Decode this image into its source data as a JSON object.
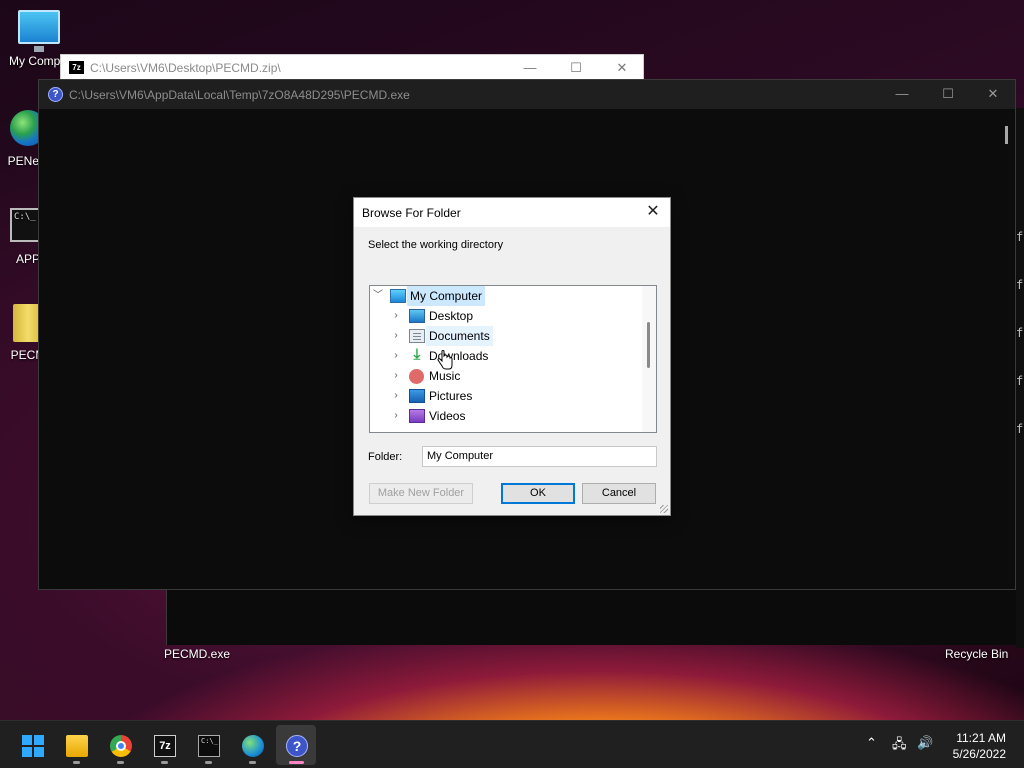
{
  "desktop": {
    "icons": [
      {
        "label": "My Compu",
        "icon": "monitor-icon"
      },
      {
        "label": "PENetv",
        "icon": "globe-icon"
      },
      {
        "label": "APP",
        "icon": "terminal-icon"
      },
      {
        "label": "PECM",
        "icon": "zip-file-icon"
      }
    ],
    "pecmd_caption": "PECMD.exe",
    "recycle_caption": "Recycle Bin",
    "right_edge_letters": [
      "f",
      "f",
      "f",
      "f",
      "f"
    ]
  },
  "window_7z": {
    "title": "C:\\Users\\VM6\\Desktop\\PECMD.zip\\",
    "app_badge": "7z"
  },
  "window_main": {
    "title": "C:\\Users\\VM6\\AppData\\Local\\Temp\\7zO8A48D295\\PECMD.exe"
  },
  "dialog": {
    "title": "Browse For Folder",
    "close_glyph": "✕",
    "instruction": "Select the working directory",
    "tree": [
      {
        "label": "My Computer",
        "icon": "computer-icon",
        "expanded": true,
        "selected": true
      },
      {
        "label": "Desktop",
        "icon": "desktop-folder-icon"
      },
      {
        "label": "Documents",
        "icon": "documents-folder-icon",
        "hovered": true
      },
      {
        "label": "Downloads",
        "icon": "downloads-folder-icon"
      },
      {
        "label": "Music",
        "icon": "music-folder-icon"
      },
      {
        "label": "Pictures",
        "icon": "pictures-folder-icon"
      },
      {
        "label": "Videos",
        "icon": "videos-folder-icon"
      },
      {
        "label": "",
        "icon": "local-disk-icon"
      }
    ],
    "folder_label": "Folder:",
    "folder_value": "My Computer",
    "buttons": {
      "make_new_folder": "Make New Folder",
      "ok": "OK",
      "cancel": "Cancel"
    }
  },
  "window_controls": {
    "minimize": "—",
    "maximize": "☐",
    "close": "✕"
  },
  "taskbar": {
    "apps": [
      {
        "name": "start",
        "icon": "windows-start-icon"
      },
      {
        "name": "file-explorer",
        "icon": "folder-icon",
        "running": true
      },
      {
        "name": "chrome",
        "icon": "chrome-icon",
        "running": true
      },
      {
        "name": "7-zip",
        "icon": "seven-zip-icon",
        "label": "7z",
        "running": true
      },
      {
        "name": "terminal",
        "icon": "terminal-icon",
        "running": true
      },
      {
        "name": "network",
        "icon": "network-globe-icon",
        "running": true
      },
      {
        "name": "pecmd",
        "icon": "help-icon",
        "label": "?",
        "running": true,
        "active": true
      }
    ],
    "tray": {
      "chevron": "⌃",
      "network_icon": "🖧",
      "volume_icon": "🔊"
    },
    "clock": {
      "time": "11:21 AM",
      "date": "5/26/2022"
    }
  },
  "colors": {
    "accent": "#0078d7",
    "selection": "#cce8ff",
    "active_indicator": "#ff84c4"
  }
}
